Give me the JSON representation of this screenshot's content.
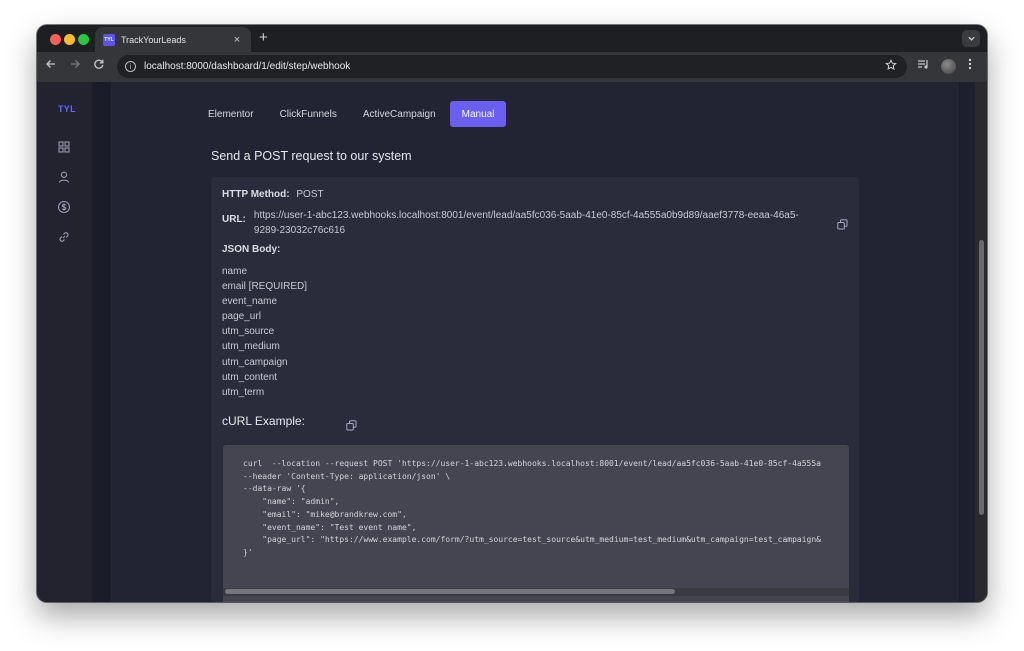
{
  "browser": {
    "tab": {
      "favicon_text": "TYL",
      "title": "TrackYourLeads",
      "close": "×"
    },
    "new_tab": "+",
    "url": "localhost:8000/dashboard/1/edit/step/webhook"
  },
  "sidebar": {
    "logo": "TYL",
    "items": [
      {
        "icon": "grid-icon"
      },
      {
        "icon": "user-icon"
      },
      {
        "icon": "dollar-icon"
      },
      {
        "icon": "link-icon"
      }
    ]
  },
  "integration_tabs": [
    {
      "label": "Elementor",
      "active": false
    },
    {
      "label": "ClickFunnels",
      "active": false
    },
    {
      "label": "ActiveCampaign",
      "active": false
    },
    {
      "label": "Manual",
      "active": true
    }
  ],
  "section_title": "Send a POST request to our system",
  "request": {
    "method_label": "HTTP Method:",
    "method_value": "POST",
    "url_label": "URL:",
    "url_value": "https://user-1-abc123.webhooks.localhost:8001/event/lead/aa5fc036-5aab-41e0-85cf-4a555a0b9d89/aaef3778-eeaa-46a5-9289-23032c76c616",
    "json_body_label": "JSON Body:",
    "fields": [
      "name",
      "email [REQUIRED]",
      "event_name",
      "page_url",
      "utm_source",
      "utm_medium",
      "utm_campaign",
      "utm_content",
      "utm_term"
    ]
  },
  "curl": {
    "title": "cURL Example:",
    "code": "curl  --location --request POST 'https://user-1-abc123.webhooks.localhost:8001/event/lead/aa5fc036-5aab-41e0-85cf-4a555a\n--header 'Content-Type: application/json' \\\n--data-raw '{\n    \"name\": \"admin\",\n    \"email\": \"mike@brandkrew.com\",\n    \"event_name\": \"Test event name\",\n    \"page_url\": \"https://www.example.com/form/?utm_source=test_source&utm_medium=test_medium&utm_campaign=test_campaign&\n}'"
  },
  "colors": {
    "accent": "#6a5ff0",
    "page_bg": "#1e1f2e",
    "card_bg": "#2a2b3b",
    "code_bg": "#454552"
  }
}
